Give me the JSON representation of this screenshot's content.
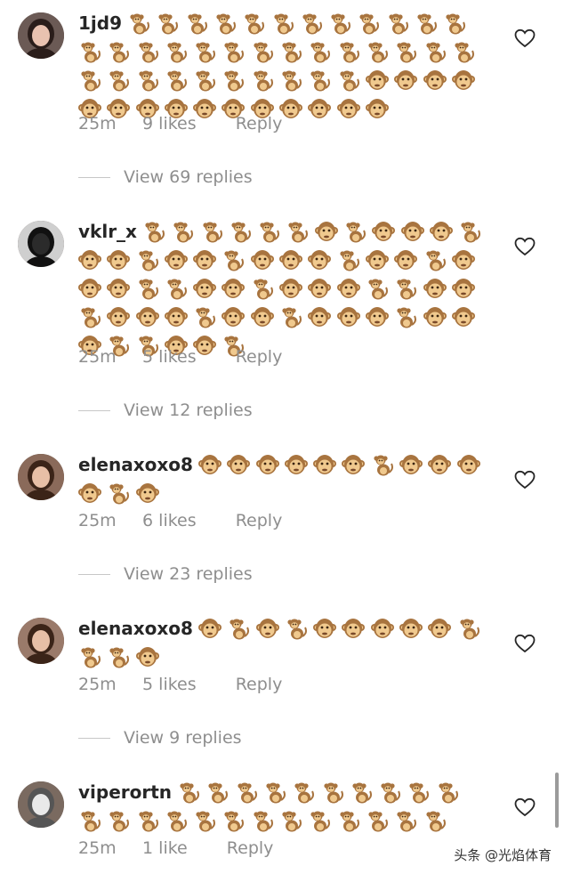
{
  "comments": [
    {
      "username": "1jd9",
      "emojis": "ssssssssssssssssssssssssssssssssssssfffffffffffffff",
      "time": "25m",
      "likes": "9 likes",
      "reply": "Reply",
      "view_replies": "View 69 replies",
      "avatar_colors": {
        "bg": "#6b5a55",
        "face": "#e9c2b0",
        "hair": "#2a1d1a"
      }
    },
    {
      "username": "vklr_x",
      "emojis": "ssssssfsfffsffsffsfffsffsfffssffsfffssffsfffsffsfffsfffssffs",
      "time": "25m",
      "likes": "5 likes",
      "reply": "Reply",
      "view_replies": "View 12 replies",
      "avatar_colors": {
        "bg": "#cfcfcf",
        "face": "#2b2b2b",
        "hair": "#111111"
      }
    },
    {
      "username": "elenaxoxo8",
      "emojis": "ffffffsffffsf",
      "time": "25m",
      "likes": "6 likes",
      "reply": "Reply",
      "view_replies": "View 23 replies",
      "avatar_colors": {
        "bg": "#8a6a5a",
        "face": "#e7bfa6",
        "hair": "#3b2418"
      }
    },
    {
      "username": "elenaxoxo8",
      "emojis": "fsfsfffffsssf",
      "time": "25m",
      "likes": "5 likes",
      "reply": "Reply",
      "view_replies": "View 9 replies",
      "avatar_colors": {
        "bg": "#9a7a6a",
        "face": "#e7bfa6",
        "hair": "#3b2418"
      }
    },
    {
      "username": "viperortn",
      "emojis": "sssssssssssssssssssssss",
      "time": "25m",
      "likes": "1 like",
      "reply": "Reply",
      "view_replies": "",
      "avatar_colors": {
        "bg": "#7a6a60",
        "face": "#e9e9e9",
        "hair": "#555555"
      }
    }
  ],
  "watermark": "头条 @光焰体育",
  "colors": {
    "monkey_fur": "#a8743f",
    "monkey_face": "#f0c98e",
    "heart_stroke": "#262626"
  }
}
